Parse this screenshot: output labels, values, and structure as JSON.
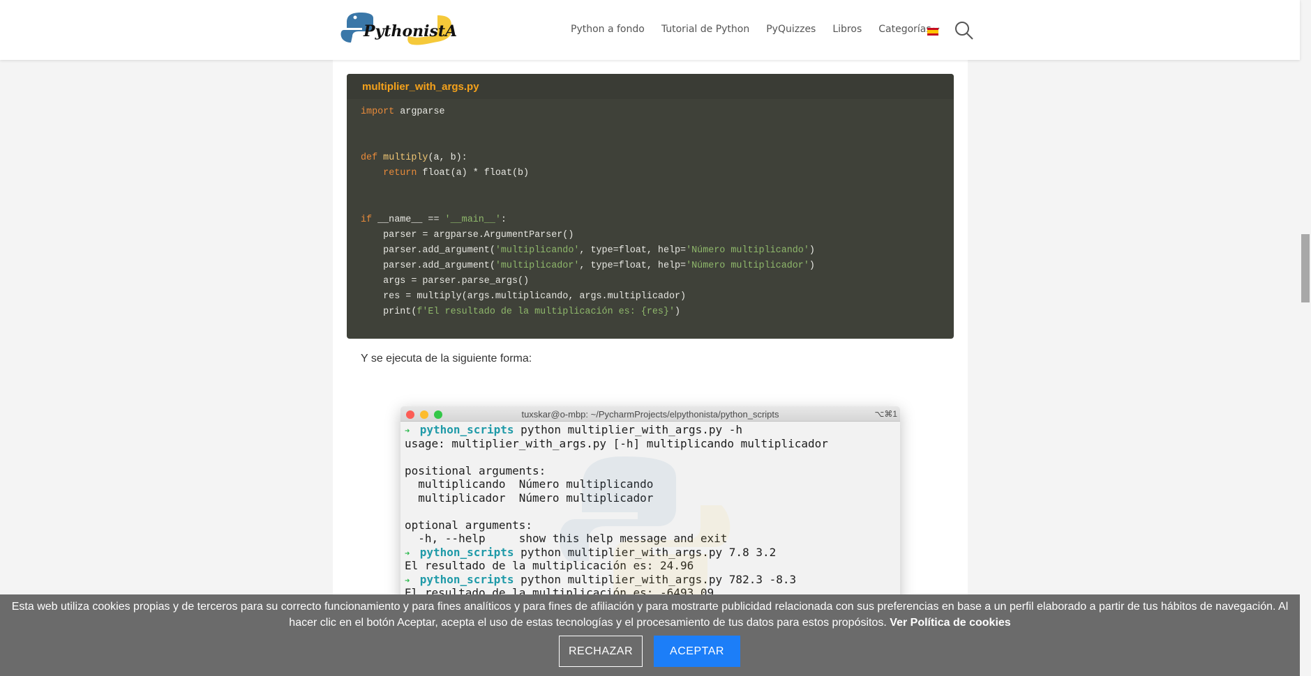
{
  "header": {
    "logo_text": "PythonistA",
    "nav": [
      "Python a fondo",
      "Tutorial de Python",
      "PyQuizzes",
      "Libros"
    ],
    "categories": "Categorías",
    "language_flag": "spain-flag-icon",
    "search_icon": "search-icon"
  },
  "code": {
    "filename": "multiplier_with_args.py",
    "lines": [
      [
        [
          "kw",
          "import"
        ],
        [
          "t",
          " argparse"
        ]
      ],
      [],
      [],
      [
        [
          "kw",
          "def"
        ],
        [
          "t",
          " "
        ],
        [
          "fn",
          "multiply"
        ],
        [
          "t",
          "(a, b):"
        ]
      ],
      [
        [
          "t",
          "    "
        ],
        [
          "kw",
          "return"
        ],
        [
          "t",
          " float(a) * float(b)"
        ]
      ],
      [],
      [],
      [
        [
          "kw",
          "if"
        ],
        [
          "t",
          " __name__ == "
        ],
        [
          "str",
          "'__main__'"
        ],
        [
          "t",
          ":"
        ]
      ],
      [
        [
          "t",
          "    parser = argparse.ArgumentParser()"
        ]
      ],
      [
        [
          "t",
          "    parser.add_argument("
        ],
        [
          "str",
          "'multiplicando'"
        ],
        [
          "t",
          ", type=float, help="
        ],
        [
          "str",
          "'Número multiplicando'"
        ],
        [
          "t",
          ")"
        ]
      ],
      [
        [
          "t",
          "    parser.add_argument("
        ],
        [
          "str",
          "'multiplicador'"
        ],
        [
          "t",
          ", type=float, help="
        ],
        [
          "str",
          "'Número multiplicador'"
        ],
        [
          "t",
          ")"
        ]
      ],
      [
        [
          "t",
          "    args = parser.parse_args()"
        ]
      ],
      [
        [
          "t",
          "    res = multiply(args.multiplicando, args.multiplicador)"
        ]
      ],
      [
        [
          "t",
          "    print("
        ],
        [
          "str",
          "f'El resultado de la multiplicación es: {res}'"
        ],
        [
          "t",
          ")"
        ]
      ]
    ]
  },
  "paragraph": "Y se ejecuta de la siguiente forma:",
  "terminal": {
    "title": "tuxskar@o-mbp: ~/PycharmProjects/elpythonista/python_scripts",
    "shortcut": "⌥⌘1",
    "lines": [
      {
        "prompt": "python_scripts",
        "cmd": " python multiplier_with_args.py -h"
      },
      {
        "text": "usage: multiplier_with_args.py [-h] multiplicando multiplicador"
      },
      {
        "text": ""
      },
      {
        "text": "positional arguments:"
      },
      {
        "text": "  multiplicando  Número multiplicando"
      },
      {
        "text": "  multiplicador  Número multiplicador"
      },
      {
        "text": ""
      },
      {
        "text": "optional arguments:"
      },
      {
        "text": "  -h, --help     show this help message and exit"
      },
      {
        "prompt": "python_scripts",
        "cmd": " python multiplier_with_args.py 7.8 3.2"
      },
      {
        "text": "El resultado de la multiplicación es: 24.96"
      },
      {
        "prompt": "python_scripts",
        "cmd": " python multiplier_with_args.py 782.3 -8.3"
      },
      {
        "text": "El resultado de la multiplicación es: -6493.09"
      }
    ]
  },
  "cookie": {
    "text": "Esta web utiliza cookies propias y de terceros para su correcto funcionamiento y para fines analíticos y para fines de afiliación y para mostrarte publicidad relacionada con sus preferencias en base a un perfil elaborado a partir de tus hábitos de navegación. Al hacer clic en el botón Aceptar, acepta el uso de estas tecnologías y el procesamiento de tus datos para estos propósitos.",
    "link": "Ver Política de cookies",
    "reject": "RECHAZAR",
    "accept": "ACEPTAR"
  },
  "colors": {
    "code_bg": "#3f4139",
    "filename": "#f5a21b",
    "keyword": "#e98b3a",
    "string": "#8fb86b",
    "accept_button": "#1c7ef8",
    "cookie_bar": "#6b6b6b"
  }
}
